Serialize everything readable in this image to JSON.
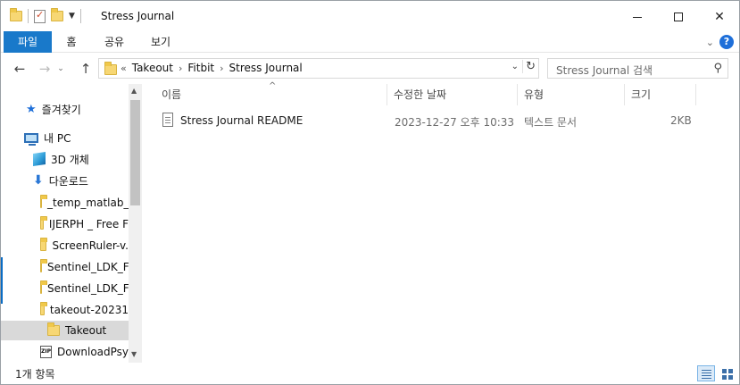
{
  "window": {
    "title": "Stress Journal"
  },
  "ribbon": {
    "tabs": [
      "파일",
      "홈",
      "공유",
      "보기"
    ]
  },
  "address": {
    "overflow": "«",
    "crumbs": [
      "Takeout",
      "Fitbit",
      "Stress Journal"
    ]
  },
  "search": {
    "placeholder": "Stress Journal 검색"
  },
  "nav": {
    "items": [
      {
        "label": "즐겨찾기",
        "icon": "star-icon"
      },
      {
        "label": "내 PC",
        "icon": "pc-icon"
      },
      {
        "label": "3D 개체",
        "icon": "cube-icon"
      },
      {
        "label": "다운로드",
        "icon": "download-icon"
      },
      {
        "label": "_temp_matlab_",
        "icon": "folder-icon"
      },
      {
        "label": "IJERPH _ Free F",
        "icon": "folder-icon"
      },
      {
        "label": "ScreenRuler-v.",
        "icon": "folder-icon"
      },
      {
        "label": "Sentinel_LDK_F",
        "icon": "folder-icon"
      },
      {
        "label": "Sentinel_LDK_F",
        "icon": "folder-icon"
      },
      {
        "label": "takeout-20231",
        "icon": "folder-icon"
      },
      {
        "label": "Takeout",
        "icon": "folder-icon"
      },
      {
        "label": "DownloadPsyc",
        "icon": "zip-icon"
      }
    ]
  },
  "columns": {
    "name": "이름",
    "date": "수정한 날짜",
    "type": "유형",
    "size": "크기"
  },
  "files": [
    {
      "name": "Stress Journal README",
      "date": "2023-12-27 오후 10:33",
      "type": "텍스트 문서",
      "size": "2KB"
    }
  ],
  "status": {
    "count": "1개 항목"
  }
}
